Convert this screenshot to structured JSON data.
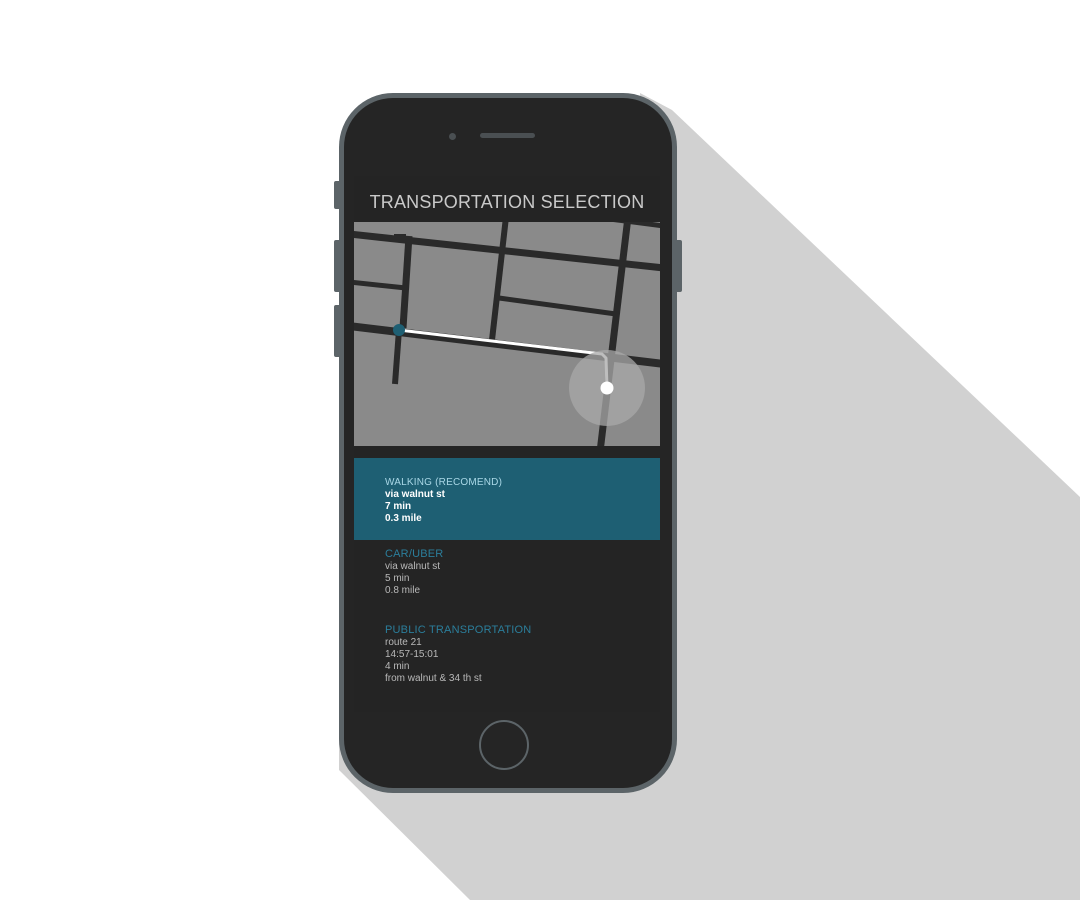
{
  "screen": {
    "title": "TRANSPORTATION SELECTION"
  },
  "map": {
    "start_icon": "start-pin-icon",
    "destination_icon": "destination-pin-icon",
    "route_color": "#ffffff",
    "start_color": "#1e5f73"
  },
  "options": [
    {
      "title": "WALKING (RECOMEND)",
      "lines": [
        "via walnut st",
        "7 min",
        "0.3 mile"
      ],
      "selected": true
    },
    {
      "title": "CAR/UBER",
      "lines": [
        "via walnut st",
        "5 min",
        "0.8 mile"
      ],
      "selected": false
    },
    {
      "title": "PUBLIC TRANSPORTATION",
      "lines": [
        "route 21",
        "14:57-15:01",
        "4 min",
        "from walnut & 34 th st"
      ],
      "selected": false
    }
  ],
  "colors": {
    "accent": "#1e5f73",
    "accent_text": "#2b7e9b",
    "screen_bg": "#242424",
    "phone_body": "#5c6468"
  }
}
